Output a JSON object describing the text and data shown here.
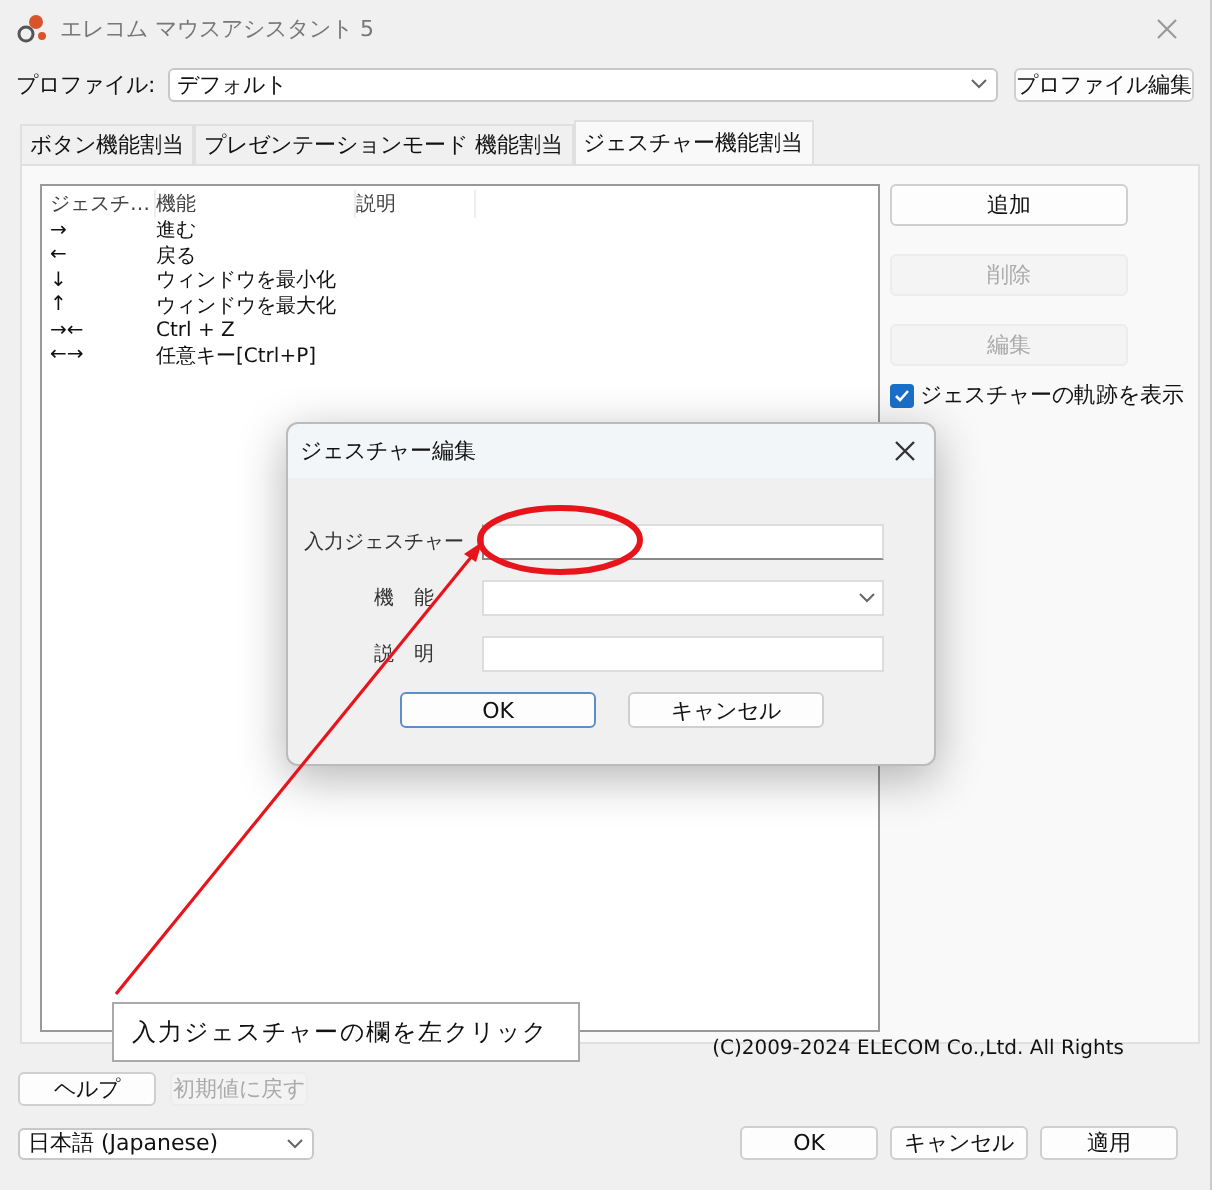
{
  "window": {
    "title": "エレコム マウスアシスタント 5"
  },
  "profile": {
    "label": "プロファイル:",
    "value": "デフォルト",
    "edit_button": "プロファイル編集"
  },
  "tabs": [
    {
      "label": "ボタン機能割当",
      "selected": false
    },
    {
      "label": "プレゼンテーションモード 機能割当",
      "selected": false
    },
    {
      "label": "ジェスチャー機能割当",
      "selected": true
    }
  ],
  "gesture_list": {
    "columns": [
      "ジェスチ…",
      "機能",
      "説明"
    ],
    "rows": [
      {
        "gesture": "→",
        "function": "進む"
      },
      {
        "gesture": "←",
        "function": "戻る"
      },
      {
        "gesture": "↓",
        "function": "ウィンドウを最小化"
      },
      {
        "gesture": "↑",
        "function": "ウィンドウを最大化"
      },
      {
        "gesture": "→←",
        "function": "Ctrl + Z"
      },
      {
        "gesture": "←→",
        "function": "任意キー[Ctrl+P]"
      }
    ]
  },
  "side_buttons": [
    {
      "label": "追加",
      "disabled": false
    },
    {
      "label": "削除",
      "disabled": true
    },
    {
      "label": "編集",
      "disabled": true
    }
  ],
  "show_trail": {
    "label": "ジェスチャーの軌跡を表示",
    "checked": true
  },
  "copyright": "(C)2009-2024 ELECOM Co.,Ltd. All Rights",
  "help_button": {
    "label": "ヘルプ",
    "disabled": false
  },
  "reset_button": {
    "label": "初期値に戻す",
    "disabled": true
  },
  "language": "日本語 (Japanese)",
  "footer_buttons": [
    "OK",
    "キャンセル",
    "適用"
  ],
  "dialog": {
    "title": "ジェスチャー編集",
    "fields": [
      {
        "label": "入力ジェスチャー",
        "kind": "text"
      },
      {
        "label": "機　能",
        "kind": "select"
      },
      {
        "label": "説　明",
        "kind": "text"
      }
    ],
    "buttons": [
      {
        "label": "OK",
        "default": true
      },
      {
        "label": "キャンセル",
        "default": false
      }
    ]
  },
  "annotation": {
    "text": "入力ジェスチャーの欄を左クリック"
  }
}
